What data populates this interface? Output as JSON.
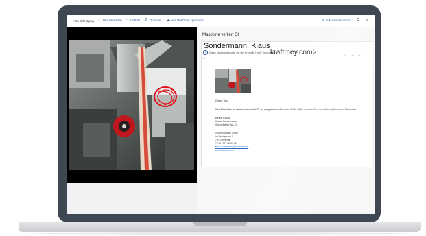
{
  "toolbar": {
    "file_name": "Foto-defekt.png",
    "download_label": "Herunterladen",
    "fullscreen_label": "Vollbild",
    "print_label": "Drucken",
    "onedrive_label": "Auf OneDrive speichern",
    "send_mail_label": "E-Mail ausblenden"
  },
  "email": {
    "subject": "Maschine verliert Öl",
    "sender_name": "Sondermann, Klaus",
    "sender_overlay": "klaus.sondermann@kraftmey.com>",
    "sender_overlay_visible": "kraftmey.com>",
    "info_line": "Diese Nachricht wurde mit der Priorität \"Hoch\" gesendet.",
    "meta_line": "An:",
    "greeting": "Guten Tag,",
    "body": "Ihre Maschine ist defekt; sie verliert Öl an der gekennzeichneten Stelle. Bitte senden Sie schnellstmöglich einen Techniker.",
    "closing": "Beste Grüße",
    "signature_name": "Klaus Sondermann",
    "signature_role": "Schichtleiter AA-Q",
    "company": "GmbH Kraftmey GmbH",
    "street": "Im Sandgewann 1",
    "city": "72072 Hirschau",
    "phone": "T +49 7071 78607 461",
    "email_link": "klaus.sondermann@kraftmey.com",
    "web_link": "www.kraftmey.com"
  },
  "icons": {
    "download": "download-icon",
    "fullscreen": "fullscreen-icon",
    "print": "print-icon",
    "onedrive": "cloud-icon",
    "mail": "mail-icon",
    "popout": "popout-icon",
    "close": "close-icon",
    "reply": "reply-icon",
    "reply_all": "reply-all-icon",
    "forward": "forward-icon",
    "more": "more-icon",
    "info": "info-icon"
  },
  "colors": {
    "accent": "#2b579a",
    "lid": "#3f4852",
    "annotation": "#e0101a"
  }
}
